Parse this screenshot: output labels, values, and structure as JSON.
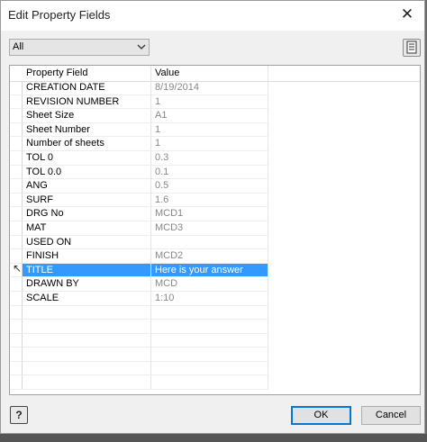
{
  "window": {
    "title": "Edit Property Fields"
  },
  "filter": {
    "selected": "All"
  },
  "grid": {
    "columns": [
      "Property Field",
      "Value"
    ],
    "rows": [
      {
        "field": "CREATION DATE",
        "value": "8/19/2014"
      },
      {
        "field": "REVISION NUMBER",
        "value": "1"
      },
      {
        "field": "Sheet Size",
        "value": "A1"
      },
      {
        "field": "Sheet Number",
        "value": "1"
      },
      {
        "field": "Number of sheets",
        "value": "1"
      },
      {
        "field": "TOL 0",
        "value": "0.3"
      },
      {
        "field": "TOL 0.0",
        "value": "0.1"
      },
      {
        "field": "ANG",
        "value": "0.5"
      },
      {
        "field": "SURF",
        "value": "1.6"
      },
      {
        "field": "DRG No",
        "value": "MCD1"
      },
      {
        "field": "MAT",
        "value": "MCD3"
      },
      {
        "field": "USED ON",
        "value": ""
      },
      {
        "field": "FINISH",
        "value": "MCD2"
      },
      {
        "field": "TITLE",
        "value": "Here is your answer"
      },
      {
        "field": "DRAWN BY",
        "value": "MCD"
      },
      {
        "field": "SCALE",
        "value": "1:10"
      }
    ],
    "selected_index": 13,
    "empty_row_count": 6
  },
  "buttons": {
    "ok": "OK",
    "cancel": "Cancel",
    "help": "?"
  },
  "icons": {
    "close": "close-icon",
    "dropdown": "chevron-down-icon",
    "sheet": "sheet-list-icon",
    "help": "help-icon",
    "cursor": "mouse-pointer-icon"
  },
  "colors": {
    "selection": "#3399ff",
    "value_text": "#888888"
  }
}
